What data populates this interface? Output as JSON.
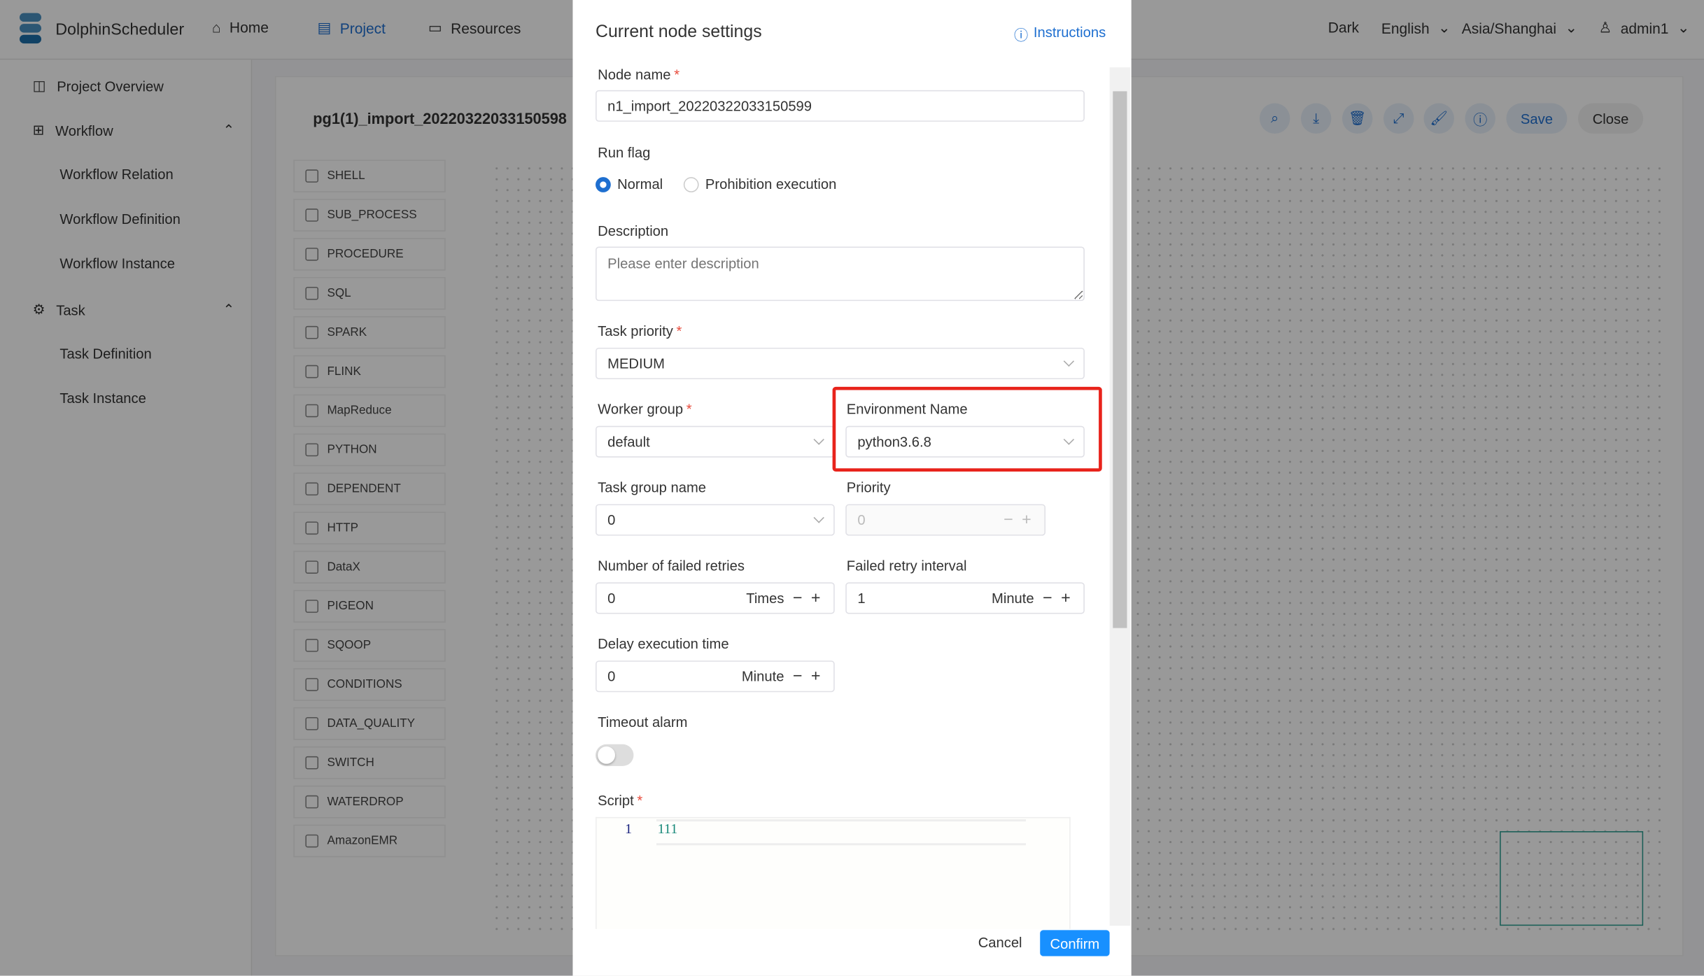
{
  "header": {
    "brand": "DolphinScheduler",
    "nav": [
      "Home",
      "Project",
      "Resources"
    ],
    "theme": "Dark",
    "language": "English",
    "timezone": "Asia/Shanghai",
    "user": "admin1",
    "accent": "#1e6fd0"
  },
  "sidebar": {
    "items": [
      {
        "label": "Project Overview"
      },
      {
        "label": "Workflow"
      },
      {
        "label": "Workflow Relation"
      },
      {
        "label": "Workflow Definition"
      },
      {
        "label": "Workflow Instance"
      },
      {
        "label": "Task"
      },
      {
        "label": "Task Definition"
      },
      {
        "label": "Task Instance"
      }
    ]
  },
  "workflow": {
    "title": "pg1(1)_import_20220322033150598",
    "save": "Save",
    "close": "Close",
    "tools": [
      "SHELL",
      "SUB_PROCESS",
      "PROCEDURE",
      "SQL",
      "SPARK",
      "FLINK",
      "MapReduce",
      "PYTHON",
      "DEPENDENT",
      "HTTP",
      "DataX",
      "PIGEON",
      "SQOOP",
      "CONDITIONS",
      "DATA_QUALITY",
      "SWITCH",
      "WATERDROP",
      "AmazonEMR"
    ]
  },
  "modal": {
    "title": "Current node settings",
    "instructions": "Instructions",
    "node_name_label": "Node name",
    "node_name": "n1_import_20220322033150599",
    "run_flag_label": "Run flag",
    "run_flag_options": [
      "Normal",
      "Prohibition execution"
    ],
    "run_flag_selected": "Normal",
    "description_label": "Description",
    "description_placeholder": "Please enter description",
    "task_priority_label": "Task priority",
    "task_priority": "MEDIUM",
    "worker_group_label": "Worker group",
    "worker_group": "default",
    "environment_label": "Environment Name",
    "environment": "python3.6.8",
    "task_group_label": "Task group name",
    "task_group": "0",
    "priority_label": "Priority",
    "priority": "0",
    "retries_label": "Number of failed retries",
    "retries": "0",
    "retries_unit": "Times",
    "retry_interval_label": "Failed retry interval",
    "retry_interval": "1",
    "retry_interval_unit": "Minute",
    "delay_label": "Delay execution time",
    "delay": "0",
    "delay_unit": "Minute",
    "timeout_label": "Timeout alarm",
    "timeout_enabled": false,
    "script_label": "Script",
    "script_line_no": "1",
    "script_line": "111",
    "cancel": "Cancel",
    "confirm": "Confirm",
    "highlight_color": "#e8231b"
  }
}
